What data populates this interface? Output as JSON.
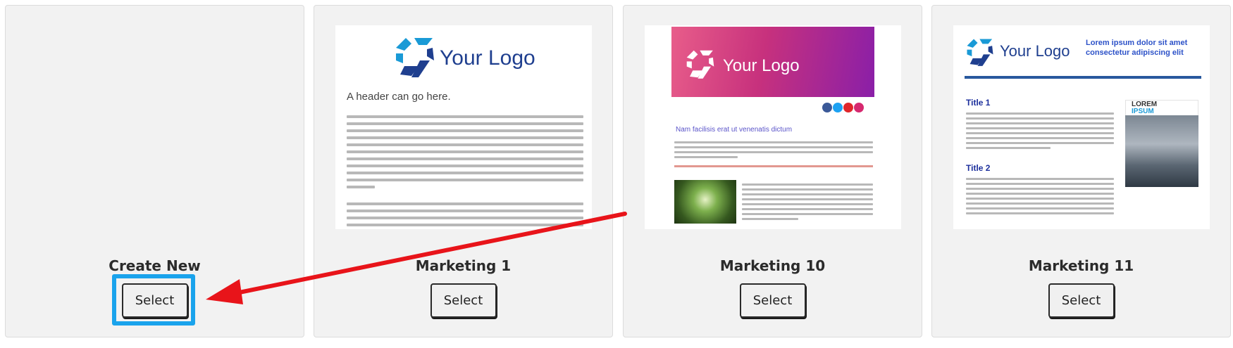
{
  "cards": [
    {
      "title": "Create New",
      "button_label": "Select"
    },
    {
      "title": "Marketing 1",
      "button_label": "Select",
      "thumbnail": {
        "logo_text": "Your Logo",
        "header_text": "A header can go here."
      }
    },
    {
      "title": "Marketing 10",
      "button_label": "Select",
      "thumbnail": {
        "logo_text": "Your Logo",
        "heading_text": "Nam facilisis erat ut venenatis dictum"
      }
    },
    {
      "title": "Marketing 11",
      "button_label": "Select",
      "thumbnail": {
        "logo_text": "Your Logo",
        "tagline": "Lorem ipsum dolor sit amet consectetur adipiscing elit",
        "title1": "Title 1",
        "title2": "Title 2",
        "image_label_1": "LOREM",
        "image_label_2": "IPSUM"
      }
    }
  ],
  "colors": {
    "highlight": "#1aa3ec",
    "arrow": "#e8141a",
    "logo_blue": "#1f3f8f",
    "logo_accent": "#1a9ad6"
  }
}
